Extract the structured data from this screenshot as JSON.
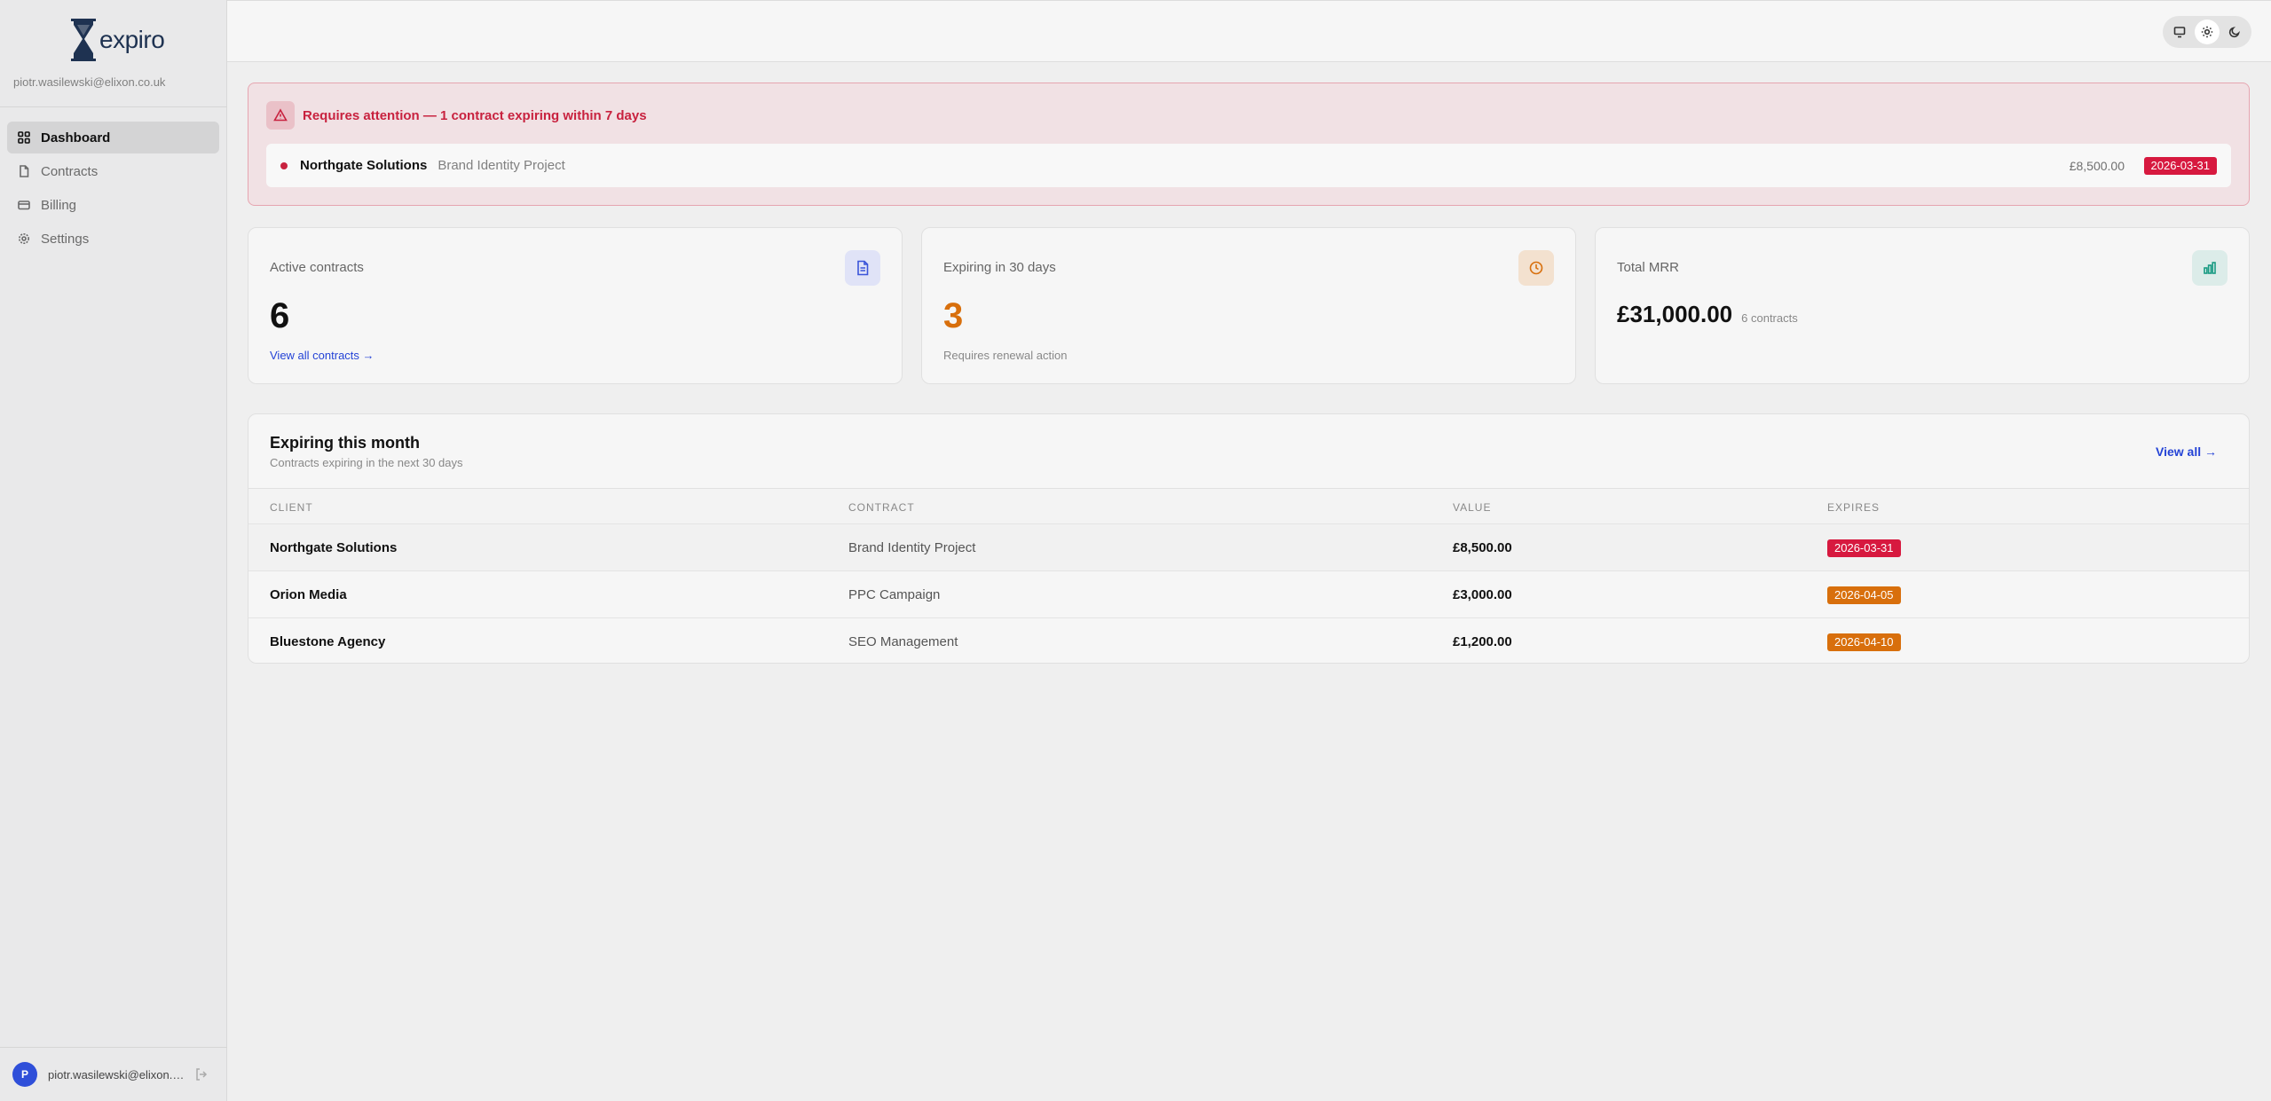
{
  "sidebar": {
    "brand": "expiro",
    "account_email": "piotr.wasilewski@elixon.co.uk",
    "nav": [
      {
        "label": "Dashboard",
        "icon": "grid-icon",
        "active": true
      },
      {
        "label": "Contracts",
        "icon": "file-icon",
        "active": false
      },
      {
        "label": "Billing",
        "icon": "card-icon",
        "active": false
      },
      {
        "label": "Settings",
        "icon": "gear-icon",
        "active": false
      }
    ],
    "user": {
      "initial": "P",
      "email": "piotr.wasilewski@elixon.c..."
    }
  },
  "topbar": {
    "theme_options": [
      "monitor-icon",
      "sun-icon",
      "moon-icon"
    ],
    "active_theme": "sun-icon"
  },
  "alert": {
    "title": "Requires attention — 1 contract expiring within 7 days",
    "item": {
      "client": "Northgate Solutions",
      "contract": "Brand Identity Project",
      "value": "£8,500.00",
      "expires": "2026-03-31"
    }
  },
  "cards": {
    "active": {
      "title": "Active contracts",
      "value": "6",
      "link": "View all contracts →"
    },
    "expiring": {
      "title": "Expiring in 30 days",
      "value": "3",
      "sub": "Requires renewal action"
    },
    "mrr": {
      "title": "Total MRR",
      "value": "£31,000.00",
      "sub": "6 contracts"
    }
  },
  "expiring_table": {
    "title": "Expiring this month",
    "subtitle": "Contracts expiring in the next 30 days",
    "view_all": "View all →",
    "columns": [
      "CLIENT",
      "CONTRACT",
      "VALUE",
      "EXPIRES"
    ],
    "rows": [
      {
        "client": "Northgate Solutions",
        "contract": "Brand Identity Project",
        "value": "£8,500.00",
        "expires": "2026-03-31",
        "status": "red"
      },
      {
        "client": "Orion Media",
        "contract": "PPC Campaign",
        "value": "£3,000.00",
        "expires": "2026-04-05",
        "status": "orange"
      },
      {
        "client": "Bluestone Agency",
        "contract": "SEO Management",
        "value": "£1,200.00",
        "expires": "2026-04-10",
        "status": "orange"
      }
    ]
  },
  "colors": {
    "accent_blue": "#2443d6",
    "danger": "#d7193f",
    "warning": "#d86f0c",
    "brand_navy": "#1e3251"
  }
}
